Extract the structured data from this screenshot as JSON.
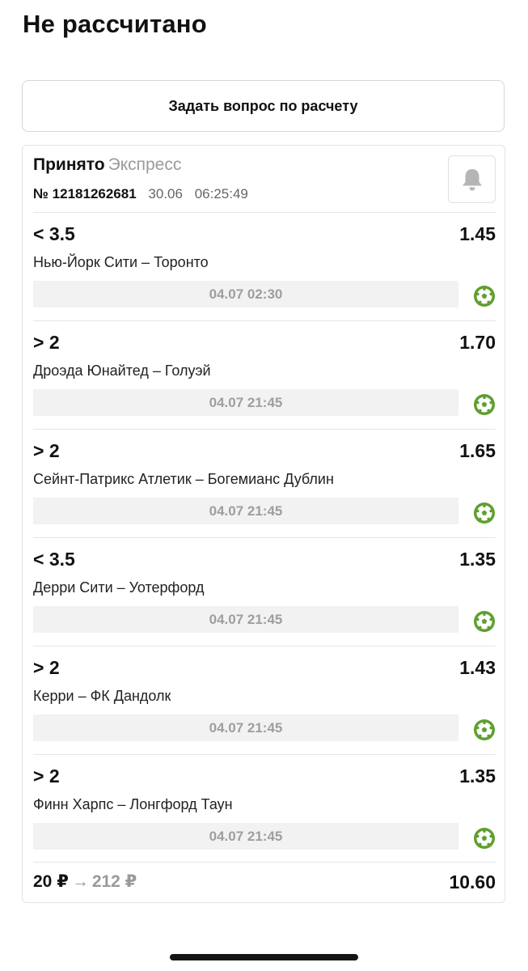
{
  "page": {
    "title": "Не рассчитано"
  },
  "ask_button": {
    "label": "Задать вопрос по расчету"
  },
  "bet": {
    "status": "Принято",
    "type": "Экспресс",
    "number": "№ 12181262681",
    "date": "30.06",
    "time": "06:25:49",
    "bell_icon": "bell-icon"
  },
  "events": [
    {
      "line": "< 3.5",
      "coef": "1.45",
      "teams": "Нью-Йорк Сити – Торонто",
      "datetime": "04.07 02:30",
      "sport_icon": "football-icon"
    },
    {
      "line": "> 2",
      "coef": "1.70",
      "teams": "Дроэда Юнайтед – Голуэй",
      "datetime": "04.07 21:45",
      "sport_icon": "football-icon"
    },
    {
      "line": "> 2",
      "coef": "1.65",
      "teams": "Сейнт-Патрикс Атлетик – Богемианс Дублин",
      "datetime": "04.07 21:45",
      "sport_icon": "football-icon"
    },
    {
      "line": "< 3.5",
      "coef": "1.35",
      "teams": "Дерри Сити – Уотерфорд",
      "datetime": "04.07 21:45",
      "sport_icon": "football-icon"
    },
    {
      "line": "> 2",
      "coef": "1.43",
      "teams": "Керри – ФК Дандолк",
      "datetime": "04.07 21:45",
      "sport_icon": "football-icon"
    },
    {
      "line": "> 2",
      "coef": "1.35",
      "teams": "Финн Харпс – Лонгфорд Таун",
      "datetime": "04.07 21:45",
      "sport_icon": "football-icon"
    }
  ],
  "footer": {
    "stake": "20 ₽",
    "arrow": "→",
    "payout": "212 ₽",
    "total_coef": "10.60"
  },
  "colors": {
    "accent_green": "#5f9f2f",
    "date_bg": "#f2f2f2",
    "muted": "#9a9a9a"
  }
}
